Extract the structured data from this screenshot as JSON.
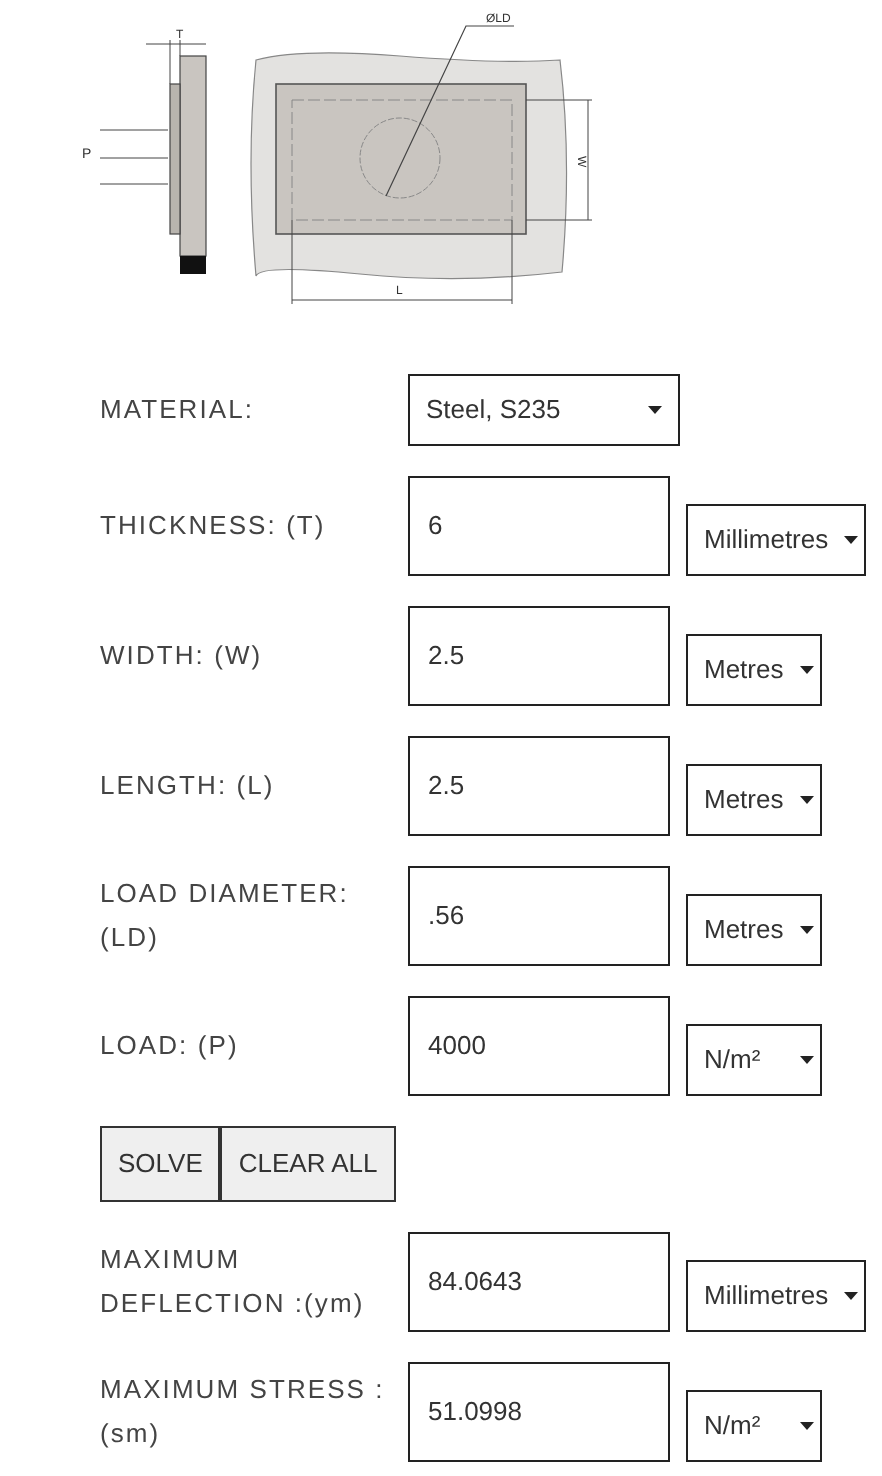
{
  "diagram": {
    "thickness_label": "T",
    "load_label": "P",
    "diameter_label": "ØLD",
    "width_label": "W",
    "length_label": "L"
  },
  "fields": [
    {
      "kind": "select",
      "label": "MATERIAL:",
      "value": "Steel, S235"
    },
    {
      "kind": "input",
      "label": "THICKNESS: (T)",
      "value": "6",
      "unit": "Millimetres"
    },
    {
      "kind": "input",
      "label": "WIDTH: (W)",
      "value": "2.5",
      "unit": "Metres"
    },
    {
      "kind": "input",
      "label": "LENGTH: (L)",
      "value": "2.5",
      "unit": "Metres"
    },
    {
      "kind": "input",
      "label": "LOAD DIAMETER: (LD)",
      "value": ".56",
      "unit": "Metres"
    },
    {
      "kind": "input",
      "label": "LOAD: (P)",
      "value": "4000",
      "unit": "N/m²"
    }
  ],
  "buttons": [
    "SOLVE",
    "CLEAR ALL"
  ],
  "results": [
    {
      "label": "MAXIMUM DEFLECTION :(ym)",
      "value": "84.0643",
      "unit": "Millimetres"
    },
    {
      "label": "MAXIMUM STRESS : (sm)",
      "value": "51.0998",
      "unit": "N/m²"
    }
  ]
}
